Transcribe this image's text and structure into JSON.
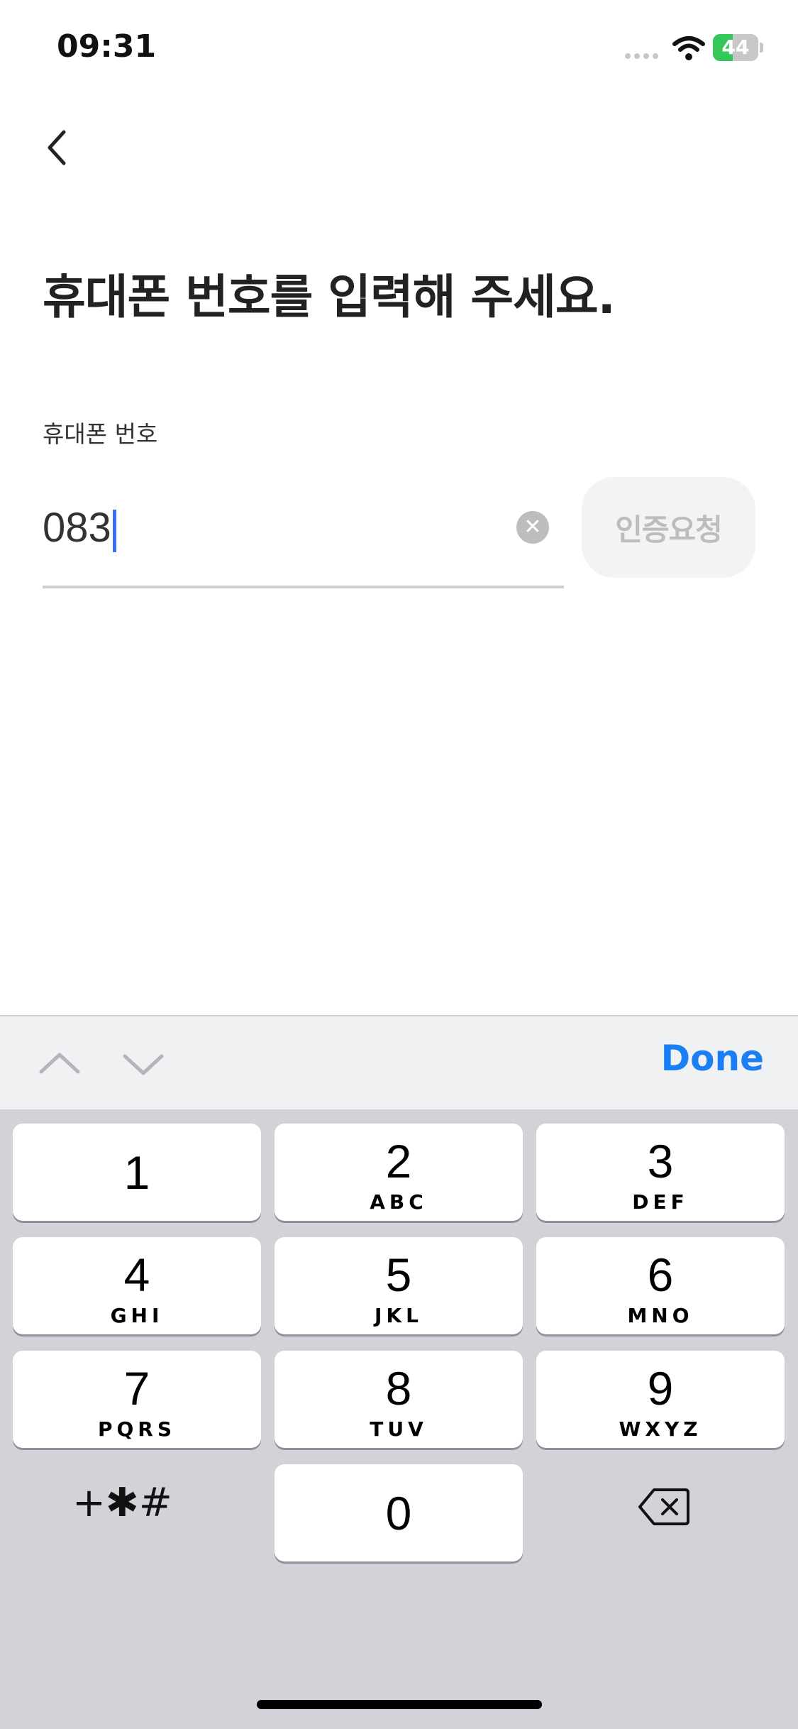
{
  "status_bar": {
    "time": "09:31",
    "battery_level": "44",
    "battery_fraction": 0.44
  },
  "header": {
    "back_icon": "chevron-left-icon"
  },
  "title": "휴대폰 번호를 입력해 주세요.",
  "form": {
    "field_label": "휴대폰 번호",
    "phone_value": "083",
    "verify_button": "인증요청"
  },
  "toolbar": {
    "done_label": "Done"
  },
  "keypad": {
    "keys": [
      {
        "num": "1",
        "letters": ""
      },
      {
        "num": "2",
        "letters": "ABC"
      },
      {
        "num": "3",
        "letters": "DEF"
      },
      {
        "num": "4",
        "letters": "GHI"
      },
      {
        "num": "5",
        "letters": "JKL"
      },
      {
        "num": "6",
        "letters": "MNO"
      },
      {
        "num": "7",
        "letters": "PQRS"
      },
      {
        "num": "8",
        "letters": "TUV"
      },
      {
        "num": "9",
        "letters": "WXYZ"
      },
      {
        "num": "0",
        "letters": ""
      }
    ],
    "symbols_label": "+✱#"
  },
  "colors": {
    "accent": "#1a7ef4",
    "caret": "#3b6cf6",
    "battery": "#34c759"
  }
}
